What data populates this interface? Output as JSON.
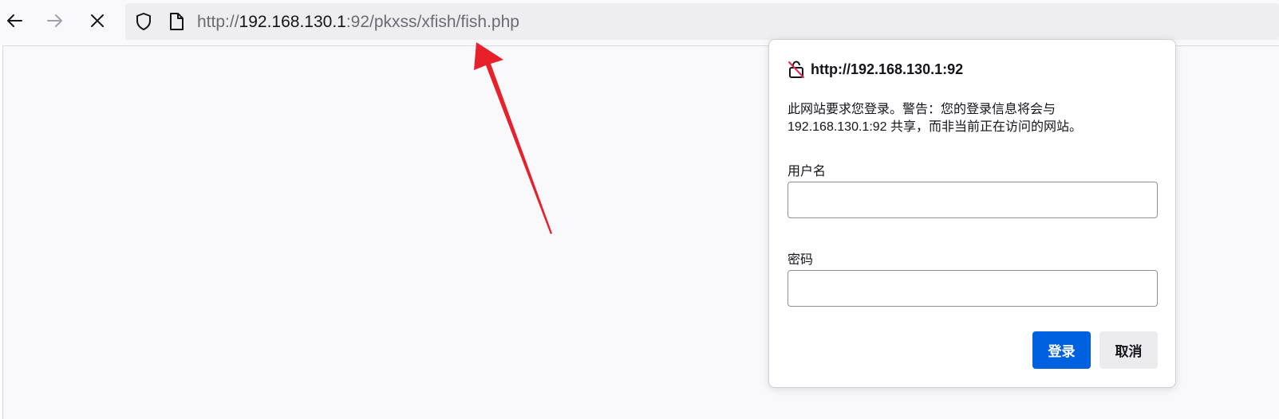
{
  "browser": {
    "back_icon": "arrow-left-icon",
    "forward_icon": "arrow-right-icon",
    "stop_icon": "close-icon",
    "url": {
      "scheme": "http://",
      "host": "192.168.130.1",
      "rest": ":92/pkxss/xfish/fish.php"
    }
  },
  "annotation": {
    "arrow_color": "#e8202a"
  },
  "auth_dialog": {
    "origin": "http://192.168.130.1:92",
    "message_line1": "此网站要求您登录。警告：您的登录信息将会与",
    "message_line2": "192.168.130.1:92 共享，而非当前正在访问的网站。",
    "username_label": "用户名",
    "username_value": "",
    "password_label": "密码",
    "password_value": "",
    "login_button": "登录",
    "cancel_button": "取消",
    "primary_color": "#0061e0"
  }
}
